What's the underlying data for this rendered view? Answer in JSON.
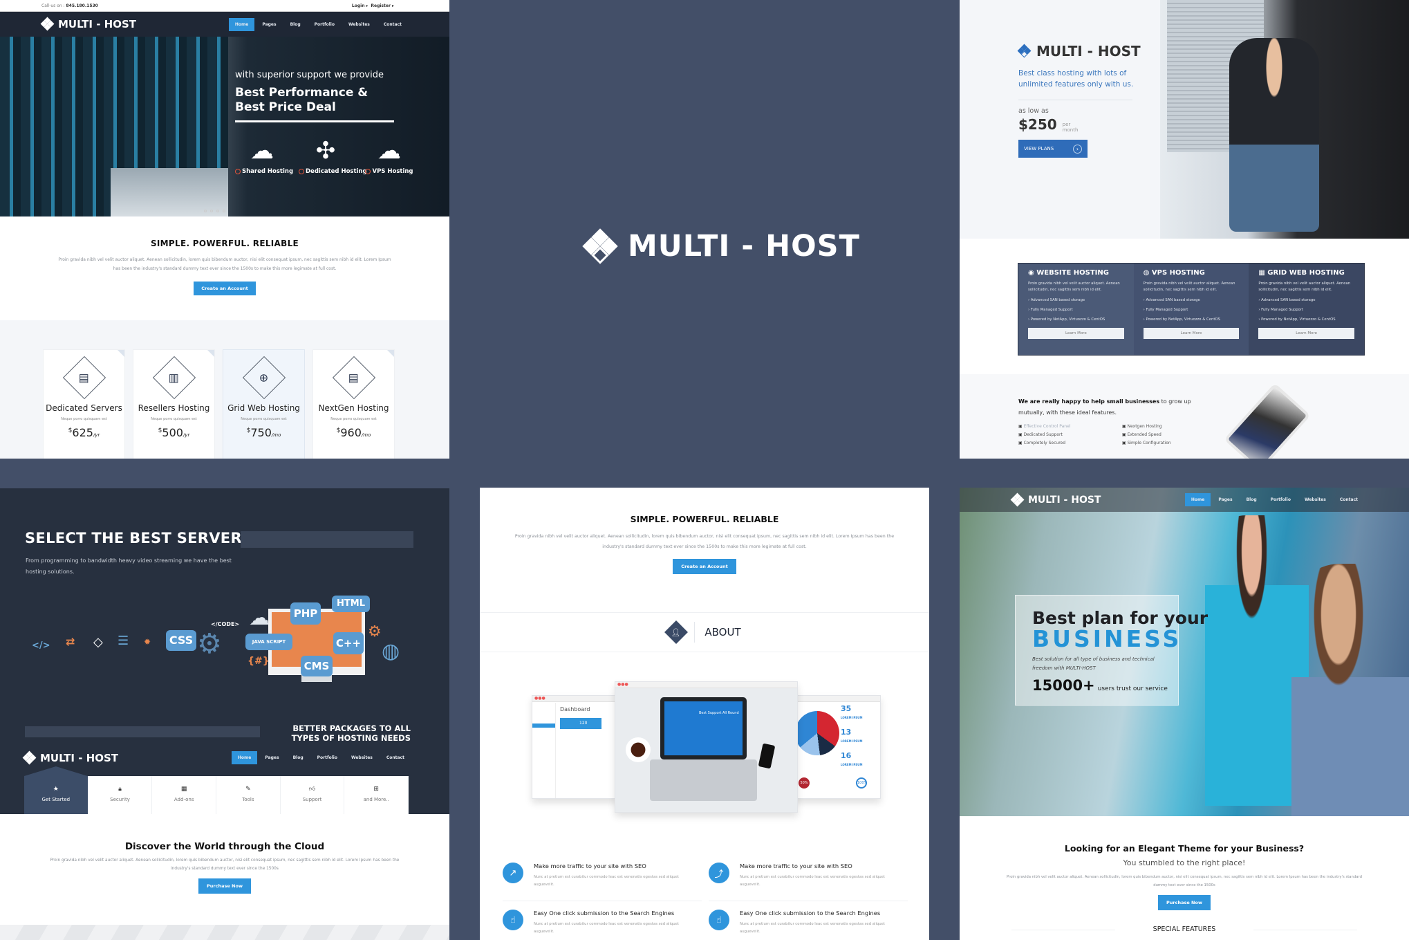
{
  "brand": {
    "name": "MULTI - HOST"
  },
  "nav": {
    "items": [
      "Home",
      "Pages",
      "Blog",
      "Portfolio",
      "Websites",
      "Contact"
    ],
    "active": "Home"
  },
  "colors": {
    "background": "#434f68",
    "accent_blue": "#2f95dc",
    "nav_dark": "#1f2735",
    "accent_orange": "#e2553b"
  },
  "top_left": {
    "topbar": {
      "call_label": "Call-us on :",
      "phone": "845.180.1530",
      "login": "Login ▸",
      "register": "Register ▸"
    },
    "hero": {
      "subtitle": "with superior support we provide",
      "title": "Best Performance & Best Price Deal",
      "services": [
        {
          "label": "Shared Hosting",
          "icon": "cloud-server-icon"
        },
        {
          "label": "Dedicated Hosting",
          "icon": "network-icon"
        },
        {
          "label": "VPS Hosting",
          "icon": "cloud-cluster-icon"
        }
      ]
    },
    "section": {
      "title": "SIMPLE. POWERFUL. RELIABLE",
      "text": "Proin gravida nibh vel velit auctor aliquet. Aenean sollicitudin, lorem quis bibendum auctor, nisi elit consequat ipsum, nec sagittis sem nibh id elit. Lorem Ipsum has been the industry's standard dummy text ever since the 1500s to make this more legimate at full cost.",
      "button": "Create an Account"
    },
    "plans": [
      {
        "name": "Dedicated Servers",
        "tagline": "Neque porro quisquam est",
        "currency": "$",
        "price": "625",
        "period": "/yr",
        "icon": "server-shield-icon",
        "highlighted": false
      },
      {
        "name": "Resellers Hosting",
        "tagline": "Neque porro quisquam est",
        "currency": "$",
        "price": "500",
        "period": "/yr",
        "icon": "servers-link-icon",
        "highlighted": false
      },
      {
        "name": "Grid Web Hosting",
        "tagline": "Neque porro quisquam est",
        "currency": "$",
        "price": "750",
        "period": "/mo",
        "icon": "server-globe-icon",
        "highlighted": true
      },
      {
        "name": "NextGen Hosting",
        "tagline": "Neque porro quisquam est",
        "currency": "$",
        "price": "960",
        "period": "/mo",
        "icon": "server-stack-icon",
        "highlighted": false
      }
    ]
  },
  "top_right": {
    "tagline": "Best class hosting with lots of unlimited features only with us.",
    "as_low_as": "as low as",
    "price": "$250",
    "per": "per",
    "period": "month",
    "button": "VIEW PLANS",
    "hosting_cards": [
      {
        "title": "WEBSITE HOSTING",
        "icon": "globe-icon",
        "text": "Proin gravida nibh vel velit auctor aliquet. Aenean sollicitudin, nec sagittis sem nibh id elit.",
        "features": [
          "Advanced SAN based storage",
          "Fully Managed Support",
          "Powered by NetApp, Virtuozzo & CentOS"
        ],
        "button": "Learn More"
      },
      {
        "title": "VPS HOSTING",
        "icon": "dashboard-icon",
        "text": "Proin gravida nibh vel velit auctor aliquet. Aenean sollicitudin, nec sagittis sem nibh id elit.",
        "features": [
          "Advanced SAN based storage",
          "Fully Managed Support",
          "Powered by NetApp, Virtuozzo & CentOS"
        ],
        "button": "Learn More"
      },
      {
        "title": "GRID WEB HOSTING",
        "icon": "grid-icon",
        "text": "Proin gravida nibh vel velit auctor aliquet. Aenean sollicitudin, nec sagittis sem nibh id elit.",
        "features": [
          "Advanced SAN based storage",
          "Fully Managed Support",
          "Powered by NetApp, Virtuozzo & CentOS"
        ],
        "button": "Learn More"
      }
    ],
    "lead_bold": "We are really happy to help small businesses",
    "lead_rest": " to grow up mutually, with these ideal features.",
    "features": [
      "Effective Control Panel",
      "Nextgen Hosting",
      "Dedicated Support",
      "Extended Speed",
      "Completely Secured",
      "Simple Configuration"
    ]
  },
  "bottom_left": {
    "title": "SELECT THE BEST SERVER",
    "subtitle": "From programming to bandwidth heavy video streaming we have the best hosting solutions.",
    "art_labels": [
      "</CODE>",
      "PHP",
      "HTML",
      "CSS",
      "JAVA SCRIPT",
      "C++",
      "CMS",
      "{#}",
      "</>"
    ],
    "packages_title": "BETTER PACKAGES TO ALL TYPES OF HOSTING NEEDS",
    "tabs": [
      {
        "label": "Get Started",
        "icon": "star-icon",
        "active": true
      },
      {
        "label": "Security",
        "icon": "lock-icon",
        "active": false
      },
      {
        "label": "Add-ons",
        "icon": "grid-icon",
        "active": false
      },
      {
        "label": "Tools",
        "icon": "wrench-icon",
        "active": false
      },
      {
        "label": "Support",
        "icon": "thumbs-up-icon",
        "active": false
      },
      {
        "label": "and More..",
        "icon": "plus-square-icon",
        "active": false
      }
    ],
    "cta": {
      "title": "Discover the World through the Cloud",
      "text": "Proin gravida nibh vel velit auctor aliquet. Aenean sollicitudin, lorem quis bibendum auctor, nisi elit consequat ipsum, nec sagittis sem nibh id elit. Lorem Ipsum has been the industry's standard dummy text ever since the 1500s",
      "button": "Purchase Now"
    }
  },
  "bottom_middle": {
    "title": "SIMPLE. POWERFUL. RELIABLE",
    "text": "Proin gravida nibh vel velit auctor aliquet. Aenean sollicitudin, lorem quis bibendum auctor, nisi elit consequat ipsum, nec sagittis sem nibh id elit. Lorem Ipsum has been the industry's standard dummy text ever since the 1500s to make this more legimate at full cost.",
    "button": "Create an Account",
    "about_label": "ABOUT",
    "mockups": {
      "dashboard_title": "Dashboard",
      "dashboard_stat": "120",
      "laptop_screen": "Best Support All Round",
      "pie_values": [
        {
          "value": "35",
          "label": "LOREM IPSUM"
        },
        {
          "value": "13",
          "label": "LOREM IPSUM"
        },
        {
          "value": "16",
          "label": "LOREM IPSUM"
        }
      ],
      "pins": [
        "50%",
        "100%"
      ]
    },
    "features": [
      {
        "title": "Make more traffic to your site with SEO",
        "text": "Nunc at pretium est curabitur commodo leac est venenatis egestas sed aliquet auguevelit.",
        "icon": "chart-up-icon"
      },
      {
        "title": "Make more traffic to your site with SEO",
        "text": "Nunc at pretium est curabitur commodo leac est venenatis egestas sed aliquet auguevelit.",
        "icon": "growth-icon"
      },
      {
        "title": "Easy One click submission to the Search Engines",
        "text": "Nunc at pretium est curabitur commodo leac est venenatis egestas sed aliquet auguevelit.",
        "icon": "hand-pointer-icon"
      },
      {
        "title": "Easy One click submission to the Search Engines",
        "text": "Nunc at pretium est curabitur commodo leac est venenatis egestas sed aliquet auguevelit.",
        "icon": "hand-pointer-icon"
      }
    ]
  },
  "bottom_right": {
    "hero_line1": "Best plan for your",
    "hero_line2": "BUSINESS",
    "hero_desc": "Best solution for all type of business and technical freedom with MULTI-HOST",
    "users_count": "15000+",
    "users_label": "users trust our service",
    "cta_title": "Looking for an Elegant Theme for your Business?",
    "cta_sub": "You stumbled to the right place!",
    "cta_text": "Proin gravida nibh vel velit auctor aliquet. Aenean sollicitudin, lorem quis bibendum auctor, nisi elit consequat ipsum, nec sagittis sem nibh id elit. Lorem Ipsum has been the industry's standard dummy text ever since the 1500s",
    "button": "Purchase Now",
    "special": "SPECIAL FEATURES"
  }
}
